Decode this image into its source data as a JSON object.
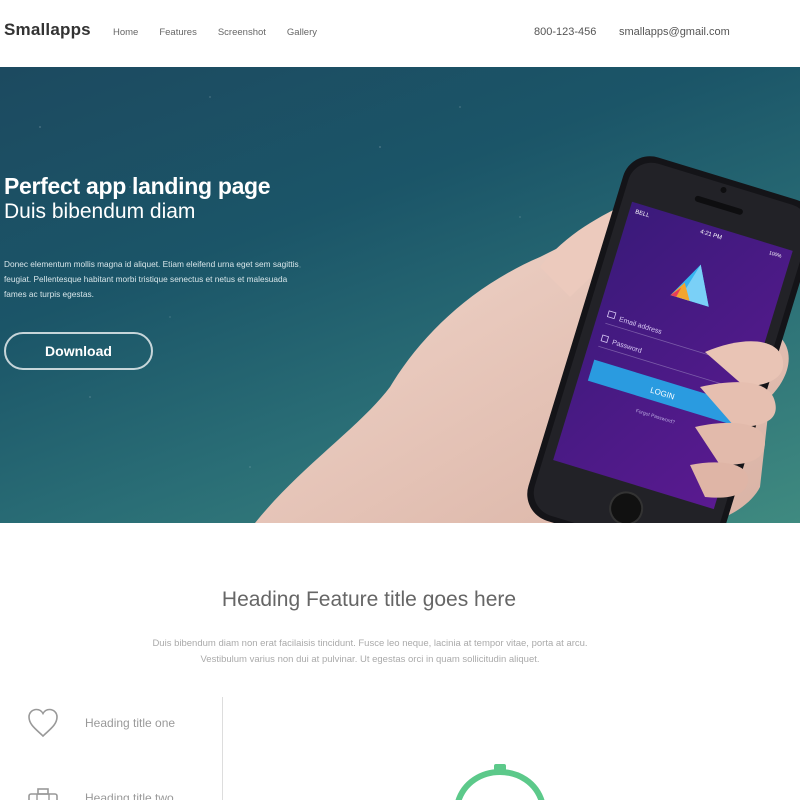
{
  "header": {
    "brand": "Smallapps",
    "nav": [
      "Home",
      "Features",
      "Screenshot",
      "Gallery"
    ],
    "phone": "800-123-456",
    "email": "smallapps@gmail.com"
  },
  "hero": {
    "title": "Perfect app landing page",
    "subtitle": "Duis bibendum diam",
    "description": "Donec elementum mollis magna id aliquet. Etiam eleifend urna eget sem sagittis feugiat. Pellentesque habitant morbi tristique senectus et netus et malesuada fames ac turpis egestas.",
    "download_label": "Download",
    "phone_screen": {
      "carrier": "BELL",
      "time": "4:21 PM",
      "battery": "100%",
      "email_placeholder": "Email address",
      "password_placeholder": "Password",
      "login_label": "LOGIN",
      "forgot_label": "Forgot Password?"
    }
  },
  "features": {
    "title": "Heading Feature title goes here",
    "description_line1": "Duis bibendum diam non erat facilaisis tincidunt. Fusce leo neque, lacinia at tempor vitae, porta at arcu.",
    "description_line2": "Vestibulum varius non dui at pulvinar. Ut egestas orci in quam sollicitudin aliquet.",
    "items": [
      {
        "label": "Heading title one",
        "icon": "heart-icon"
      },
      {
        "label": "Heading title two",
        "icon": "briefcase-icon"
      }
    ]
  },
  "colors": {
    "hero_dark": "#1c4a60",
    "hero_light": "#3f8a80",
    "screen_purple": "#4a1a8a",
    "login_blue": "#2a9be0",
    "gauge_green": "#5cc98a"
  }
}
